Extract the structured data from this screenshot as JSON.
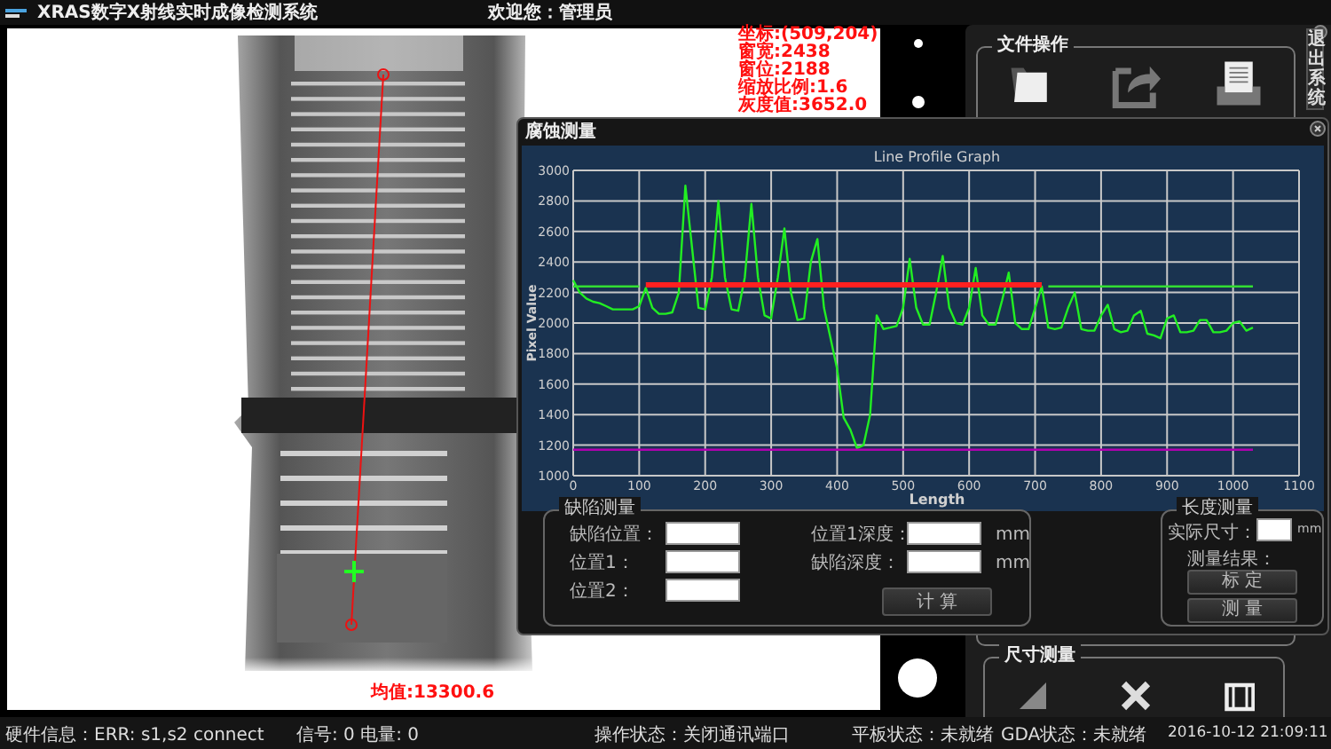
{
  "window": {
    "title": "XRAS数字X射线实时成像检测系统",
    "welcome": "欢迎您：管理员"
  },
  "image_overlay": {
    "info_lines": [
      "坐标:(509,204)",
      "窗宽:2438",
      "窗位:2188",
      "缩放比例:1.6",
      "灰度值:3652.0"
    ],
    "mean": "均值:13300.6"
  },
  "side_panel": {
    "file_group": {
      "title": "文件操作"
    },
    "side_tab": "退出系统",
    "size_group": {
      "title": "尺寸测量"
    }
  },
  "dialog": {
    "title": "腐蚀测量",
    "chart_data": {
      "type": "line",
      "title": "Line Profile Graph",
      "xlabel": "Length",
      "ylabel": "Pixel Value",
      "grid": true,
      "xlim": [
        0,
        1100
      ],
      "ylim": [
        1000,
        3000
      ],
      "xticks": [
        0,
        100,
        200,
        300,
        400,
        500,
        600,
        700,
        800,
        900,
        1000,
        1100
      ],
      "yticks": [
        1000,
        1200,
        1400,
        1600,
        1800,
        2000,
        2200,
        2400,
        2600,
        2800,
        3000
      ],
      "x": [
        0,
        10,
        20,
        30,
        40,
        50,
        60,
        70,
        80,
        90,
        100,
        110,
        120,
        130,
        140,
        150,
        160,
        170,
        180,
        190,
        200,
        210,
        220,
        230,
        240,
        250,
        260,
        270,
        280,
        290,
        300,
        310,
        320,
        330,
        340,
        350,
        360,
        370,
        380,
        390,
        400,
        410,
        420,
        430,
        440,
        450,
        460,
        470,
        480,
        490,
        500,
        510,
        520,
        530,
        540,
        550,
        560,
        570,
        580,
        590,
        600,
        610,
        620,
        630,
        640,
        650,
        660,
        670,
        680,
        690,
        700,
        710,
        720,
        730,
        740,
        750,
        760,
        770,
        780,
        790,
        800,
        810,
        820,
        830,
        840,
        850,
        860,
        870,
        880,
        890,
        900,
        910,
        920,
        930,
        940,
        950,
        960,
        970,
        980,
        990,
        1000,
        1010,
        1020,
        1030
      ],
      "series": [
        {
          "color": "#22ee22",
          "values": [
            2280,
            2200,
            2160,
            2140,
            2130,
            2110,
            2090,
            2090,
            2090,
            2090,
            2110,
            2230,
            2100,
            2060,
            2060,
            2070,
            2200,
            2900,
            2500,
            2100,
            2090,
            2300,
            2800,
            2300,
            2090,
            2080,
            2300,
            2780,
            2300,
            2050,
            2030,
            2300,
            2620,
            2200,
            2020,
            2030,
            2400,
            2550,
            2100,
            1900,
            1700,
            1380,
            1300,
            1180,
            1200,
            1400,
            2050,
            1960,
            1970,
            1980,
            2100,
            2420,
            2100,
            1990,
            1990,
            2200,
            2440,
            2100,
            2000,
            1990,
            2100,
            2360,
            2050,
            1990,
            1990,
            2150,
            2330,
            2000,
            1960,
            1960,
            2100,
            2240,
            1970,
            1960,
            1970,
            2100,
            2200,
            1960,
            1950,
            1950,
            2050,
            2120,
            1960,
            1940,
            1950,
            2050,
            2080,
            1930,
            1920,
            1900,
            2030,
            2050,
            1940,
            1940,
            1950,
            2020,
            2020,
            1940,
            1940,
            1950,
            2000,
            2010,
            1950,
            1970
          ]
        },
        {
          "color": "#33dd33",
          "values": [
            2240,
            2240,
            2240,
            2240,
            2240,
            2240,
            2240,
            2240,
            2240,
            2240,
            2240,
            null,
            null,
            null,
            null,
            null,
            null,
            null,
            null,
            null,
            null,
            null,
            null,
            null,
            null,
            null,
            null,
            null,
            null,
            null,
            null,
            null,
            null,
            null,
            null,
            null,
            null,
            null,
            null,
            null,
            null,
            null,
            null,
            null,
            null,
            null,
            null,
            null,
            null,
            null,
            null,
            null,
            null,
            null,
            null,
            null,
            null,
            null,
            null,
            null,
            null,
            null,
            null,
            null,
            null,
            null,
            null,
            null,
            null,
            null,
            null,
            null,
            2240,
            2240,
            2240,
            2240,
            2240,
            2240,
            2240,
            2240,
            2240,
            2240,
            2240,
            2240,
            2240,
            2240,
            2240,
            2240,
            2240,
            2240,
            2240,
            2240,
            2240,
            2240,
            2240,
            2240,
            2240,
            2240,
            2240,
            2240,
            2240,
            2240,
            2240,
            2240
          ]
        },
        {
          "color": "#ff2020",
          "values": [
            null,
            null,
            null,
            null,
            null,
            null,
            null,
            null,
            null,
            null,
            null,
            2250,
            2250,
            2250,
            2250,
            2250,
            2250,
            2250,
            2250,
            2250,
            2250,
            2250,
            2250,
            2250,
            2250,
            2250,
            2250,
            2250,
            2250,
            2250,
            2250,
            2250,
            2250,
            2250,
            2250,
            2250,
            2250,
            2250,
            2250,
            2250,
            2250,
            2250,
            2250,
            2250,
            2250,
            2250,
            2250,
            2250,
            2250,
            2250,
            2250,
            2250,
            2250,
            2250,
            2250,
            2250,
            2250,
            2250,
            2250,
            2250,
            2250,
            2250,
            2250,
            2250,
            2250,
            2250,
            2250,
            2250,
            2250,
            2250,
            2250,
            2250,
            null,
            null,
            null,
            null,
            null,
            null,
            null,
            null,
            null,
            null,
            null,
            null,
            null,
            null,
            null,
            null,
            null,
            null,
            null,
            null,
            null,
            null,
            null,
            null,
            null,
            null,
            null,
            null,
            null,
            null,
            null,
            null
          ]
        },
        {
          "color": "#b000b0",
          "values": [
            1170,
            1170,
            1170,
            1170,
            1170,
            1170,
            1170,
            1170,
            1170,
            1170,
            1170,
            1170,
            1170,
            1170,
            1170,
            1170,
            1170,
            1170,
            1170,
            1170,
            1170,
            1170,
            1170,
            1170,
            1170,
            1170,
            1170,
            1170,
            1170,
            1170,
            1170,
            1170,
            1170,
            1170,
            1170,
            1170,
            1170,
            1170,
            1170,
            1170,
            1170,
            1170,
            1170,
            1170,
            1170,
            1170,
            1170,
            1170,
            1170,
            1170,
            1170,
            1170,
            1170,
            1170,
            1170,
            1170,
            1170,
            1170,
            1170,
            1170,
            1170,
            1170,
            1170,
            1170,
            1170,
            1170,
            1170,
            1170,
            1170,
            1170,
            1170,
            1170,
            1170,
            1170,
            1170,
            1170,
            1170,
            1170,
            1170,
            1170,
            1170,
            1170,
            1170,
            1170,
            1170,
            1170,
            1170,
            1170,
            1170,
            1170,
            1170,
            1170,
            1170,
            1170,
            1170,
            1170,
            1170,
            1170,
            1170,
            1170,
            1170,
            1170,
            1170,
            1170
          ]
        }
      ]
    },
    "defect_group": {
      "title": "缺陷测量",
      "fields": [
        {
          "label": "缺陷位置："
        },
        {
          "label": "位置1："
        },
        {
          "label": "位置2："
        },
        {
          "label": "位置1深度：",
          "unit": "mm"
        },
        {
          "label": "缺陷深度：",
          "unit": "mm"
        }
      ],
      "button": "计 算"
    },
    "length_group": {
      "title": "长度测量",
      "size_label": "实际尺寸：",
      "unit": "mm",
      "result_label": "测量结果：",
      "buttons": [
        "标 定",
        "测 量"
      ]
    }
  },
  "status_bar": [
    "硬件信息：ERR: s1,s2 connect",
    "信号: 0  电量: 0",
    "操作状态：关闭通讯端口",
    "平板状态：未就绪",
    "GDA状态：未就绪",
    "2016-10-12 21:09:11"
  ]
}
